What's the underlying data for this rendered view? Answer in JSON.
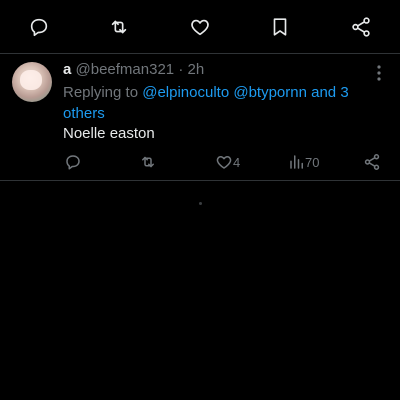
{
  "top_actions": [
    "reply-icon",
    "retweet-icon",
    "like-icon",
    "bookmark-icon",
    "share-icon"
  ],
  "reply": {
    "author_name": "a",
    "handle": "@beefman321",
    "separator": " · ",
    "time": "2h",
    "replying_prefix": "Replying to ",
    "mention_1": "@elpinoculto",
    "mention_2": "@btypornn",
    "others_text": "and 3 others",
    "text": "Noelle easton",
    "likes": "4",
    "views": "70"
  },
  "colors": {
    "background": "#000000",
    "text": "#e7e9ea",
    "muted": "#71767b",
    "link": "#1d9bf0",
    "divider": "#2f3336"
  }
}
